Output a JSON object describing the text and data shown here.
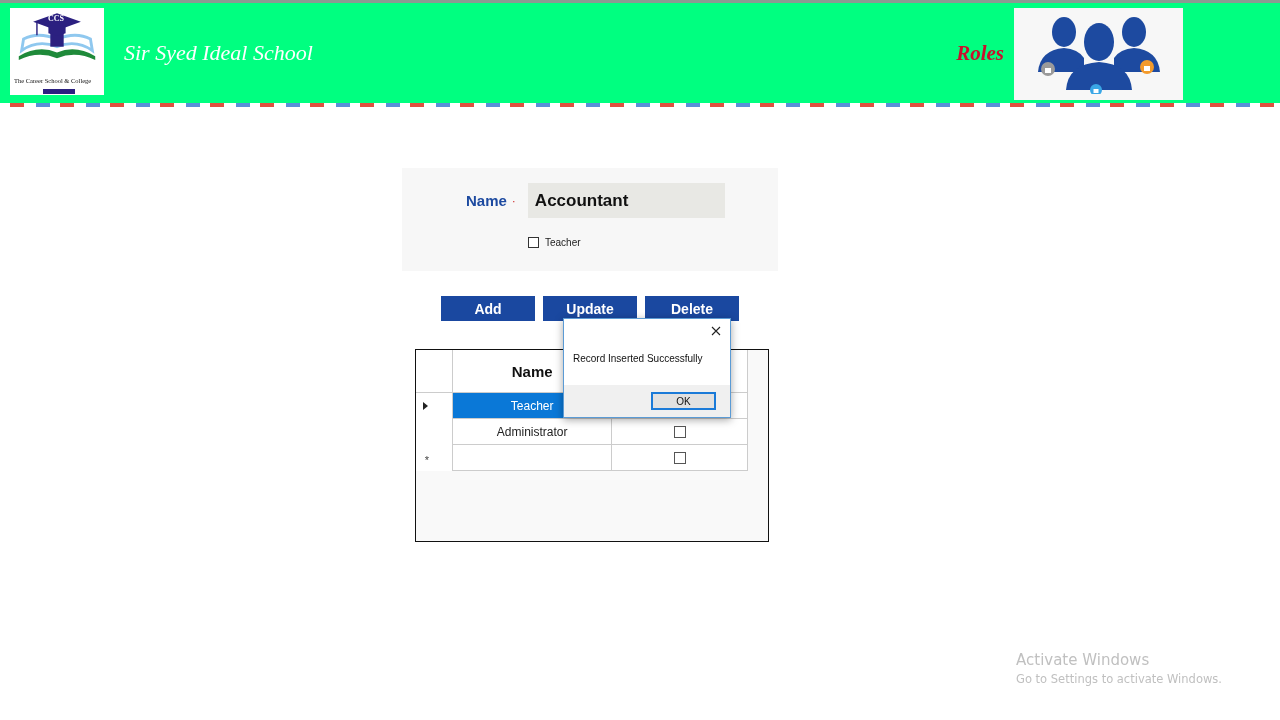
{
  "header": {
    "logo": {
      "monogram": "CCS",
      "caption": "The Career School & College"
    },
    "title": "Sir Syed Ideal School",
    "page_title": "Roles"
  },
  "form": {
    "name_label": "Name",
    "required_mark": "·",
    "name_value": "Accountant",
    "checkbox": {
      "label": "Teacher",
      "checked": false
    }
  },
  "buttons": [
    "Add",
    "Update",
    "Delete"
  ],
  "grid": {
    "columns": [
      "Name"
    ],
    "rows": [
      {
        "kind": "current",
        "name": "Teacher",
        "selected": true
      },
      {
        "kind": "data",
        "name": "Administrator",
        "selected": false,
        "checked": false
      },
      {
        "kind": "new",
        "marker": "*",
        "selected": false,
        "checked": false
      }
    ]
  },
  "dialog": {
    "message": "Record Inserted Successfully",
    "button": "OK"
  },
  "os_notice": {
    "title": "Activate Windows",
    "subtitle": "Go to Settings to activate Windows."
  }
}
